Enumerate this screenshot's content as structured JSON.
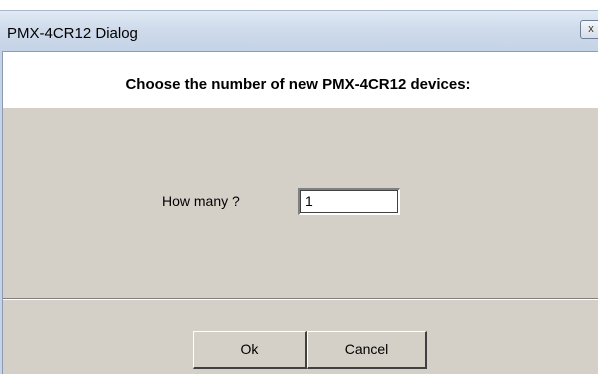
{
  "dialog": {
    "title": "PMX-4CR12 Dialog",
    "close_glyph": "x",
    "header": "Choose the number of new PMX-4CR12 devices:",
    "how_many_label": "How many ?",
    "how_many_value": "1",
    "ok_label": "Ok",
    "cancel_label": "Cancel"
  },
  "colors": {
    "dialog_bg": "#d4d0c8",
    "header_bg": "#ffffff",
    "titlebar": "#cfdbeb"
  }
}
